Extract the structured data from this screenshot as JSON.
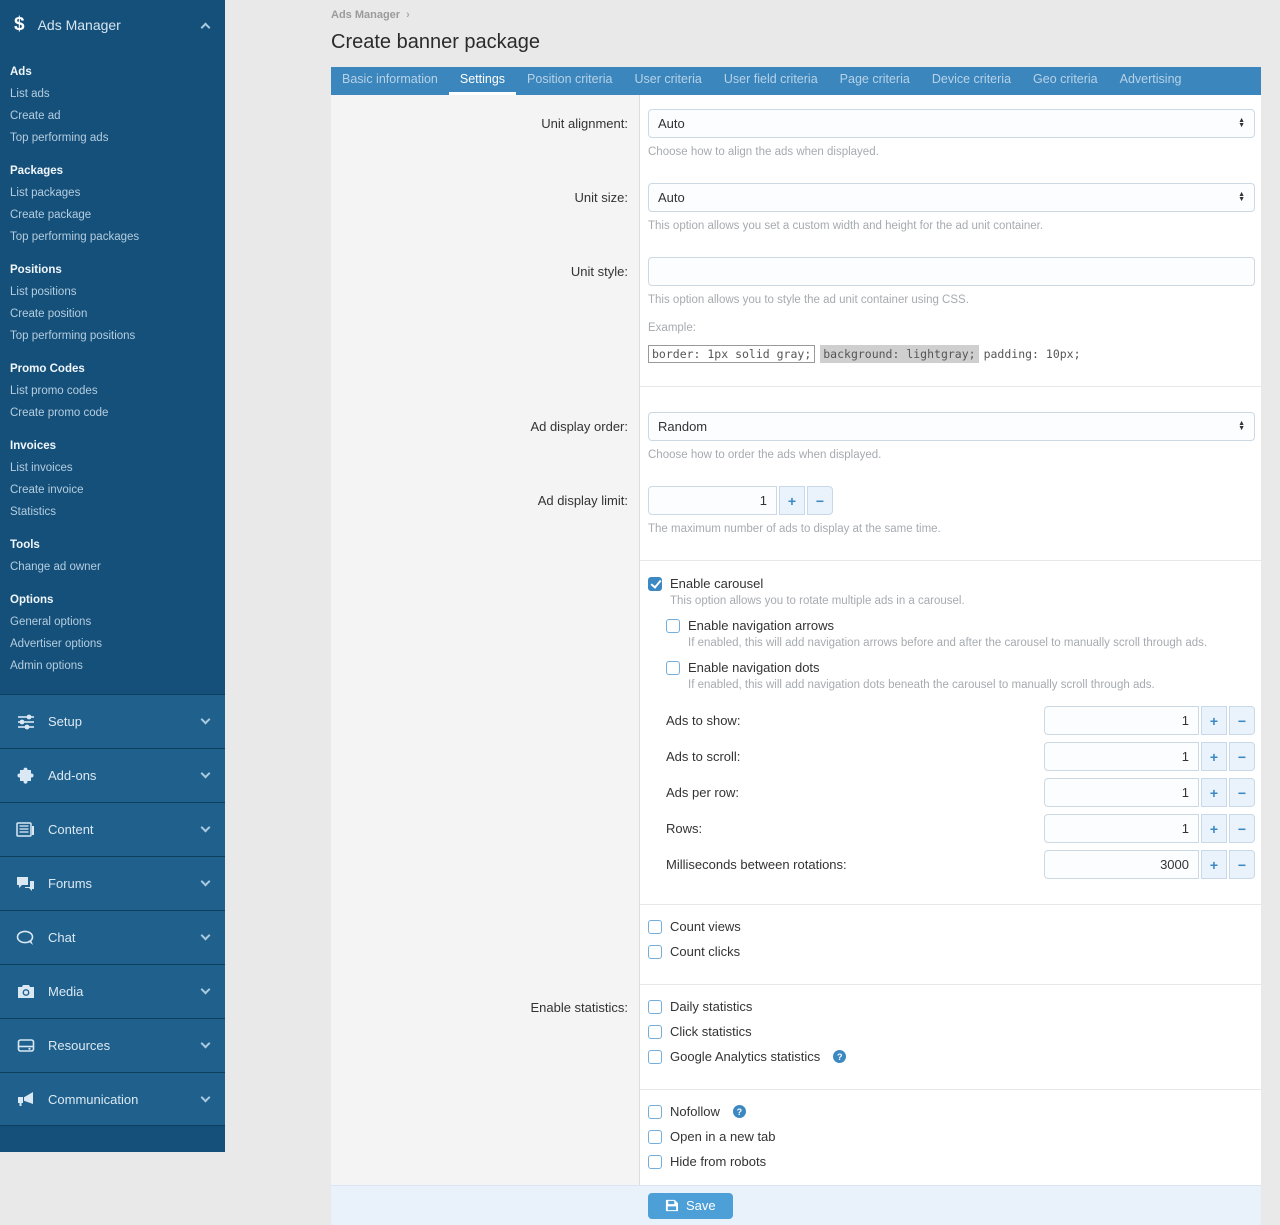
{
  "colors": {
    "sidebar": "#15507a",
    "sidebar_row": "#1f608d",
    "tabbar": "#3a86bd",
    "accent": "#3b88c3",
    "save_button": "#4d9fd8",
    "label_column": "#f4f4f4",
    "footer": "#e9f1fa"
  },
  "icons": {
    "dollar": "$",
    "spinner_up": "▲",
    "spinner_down": "▼",
    "plus": "+",
    "minus": "−",
    "help": "?",
    "breadcrumb_sep": "›"
  },
  "sidebar": {
    "title": "Ads Manager",
    "groups": [
      {
        "title": "Ads",
        "items": [
          "List ads",
          "Create ad",
          "Top performing ads"
        ]
      },
      {
        "title": "Packages",
        "items": [
          "List packages",
          "Create package",
          "Top performing packages"
        ]
      },
      {
        "title": "Positions",
        "items": [
          "List positions",
          "Create position",
          "Top performing positions"
        ]
      },
      {
        "title": "Promo Codes",
        "items": [
          "List promo codes",
          "Create promo code"
        ]
      },
      {
        "title": "Invoices",
        "items": [
          "List invoices",
          "Create invoice",
          "Statistics"
        ]
      },
      {
        "title": "Tools",
        "items": [
          "Change ad owner"
        ]
      },
      {
        "title": "Options",
        "items": [
          "General options",
          "Advertiser options",
          "Admin options"
        ]
      }
    ],
    "accordions": [
      {
        "label": "Setup",
        "icon": "sliders-icon"
      },
      {
        "label": "Add-ons",
        "icon": "puzzle-icon"
      },
      {
        "label": "Content",
        "icon": "newspaper-icon"
      },
      {
        "label": "Forums",
        "icon": "comments-icon"
      },
      {
        "label": "Chat",
        "icon": "chat-icon"
      },
      {
        "label": "Media",
        "icon": "camera-icon"
      },
      {
        "label": "Resources",
        "icon": "drive-icon"
      },
      {
        "label": "Communication",
        "icon": "megaphone-icon"
      }
    ]
  },
  "breadcrumb": {
    "label": "Ads Manager"
  },
  "page_title": "Create banner package",
  "tabs": {
    "active": "Settings",
    "items": [
      "Basic information",
      "Settings",
      "Position criteria",
      "User criteria",
      "User field criteria",
      "Page criteria",
      "Device criteria",
      "Geo criteria",
      "Advertising"
    ]
  },
  "form": {
    "unit_alignment": {
      "label": "Unit alignment:",
      "value": "Auto",
      "help": "Choose how to align the ads when displayed."
    },
    "unit_size": {
      "label": "Unit size:",
      "value": "Auto",
      "help": "This option allows you set a custom width and height for the ad unit container."
    },
    "unit_style": {
      "label": "Unit style:",
      "value": "",
      "help": "This option allows you to style the ad unit container using CSS.",
      "example_label": "Example:",
      "example_parts": [
        "border: 1px solid gray;",
        "background: lightgray;",
        "padding: 10px;"
      ]
    },
    "ad_display_order": {
      "label": "Ad display order:",
      "value": "Random",
      "help": "Choose how to order the ads when displayed."
    },
    "ad_display_limit": {
      "label": "Ad display limit:",
      "value": "1",
      "help": "The maximum number of ads to display at the same time."
    },
    "carousel": {
      "label": "Enable carousel",
      "checked": true,
      "help": "This option allows you to rotate multiple ads in a carousel.",
      "arrows": {
        "label": "Enable navigation arrows",
        "help": "If enabled, this will add navigation arrows before and after the carousel to manually scroll through ads."
      },
      "dots": {
        "label": "Enable navigation dots",
        "help": "If enabled, this will add navigation dots beneath the carousel to manually scroll through ads."
      },
      "numbers": [
        {
          "label": "Ads to show:",
          "value": "1"
        },
        {
          "label": "Ads to scroll:",
          "value": "1"
        },
        {
          "label": "Ads per row:",
          "value": "1"
        },
        {
          "label": "Rows:",
          "value": "1"
        },
        {
          "label": "Milliseconds between rotations:",
          "value": "3000"
        }
      ]
    },
    "counts": [
      {
        "label": "Count views"
      },
      {
        "label": "Count clicks"
      }
    ],
    "statistics": {
      "label": "Enable statistics:",
      "options": [
        {
          "label": "Daily statistics"
        },
        {
          "label": "Click statistics"
        },
        {
          "label": "Google Analytics statistics",
          "has_help": true
        }
      ]
    },
    "flags": [
      {
        "label": "Nofollow",
        "has_help": true
      },
      {
        "label": "Open in a new tab"
      },
      {
        "label": "Hide from robots"
      }
    ],
    "save_label": "Save"
  }
}
